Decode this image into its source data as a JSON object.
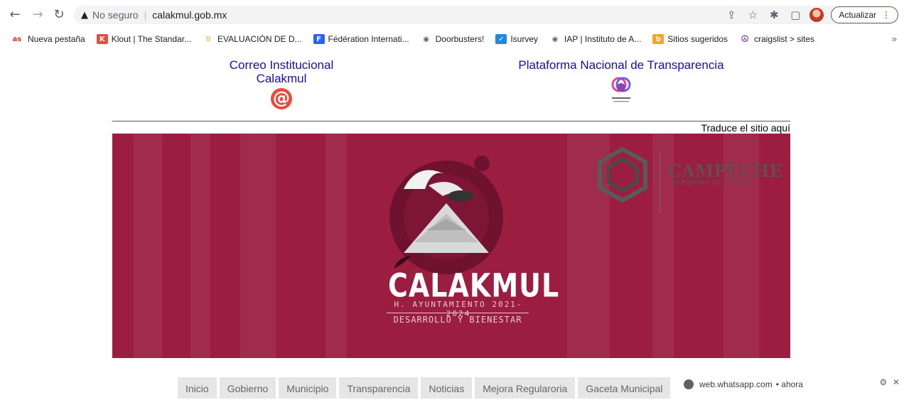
{
  "browser": {
    "security_label": "No seguro",
    "url": "calakmul.gob.mx",
    "update_label": "Actualizar"
  },
  "bookmarks": [
    {
      "label": "Nueva pestaña",
      "icon": "as-icon",
      "icon_text": "as",
      "color": "#c0392b"
    },
    {
      "label": "Klout | The Standar...",
      "icon": "klout-icon",
      "icon_text": "K",
      "color": "#e74c3c"
    },
    {
      "label": "EVALUACIÓN DE D...",
      "icon": "trophy-icon",
      "icon_text": "♉",
      "color": "#f39c12"
    },
    {
      "label": "Fédération Internati...",
      "icon": "f-icon",
      "icon_text": "F",
      "color": "#2962ff"
    },
    {
      "label": "Doorbusters!",
      "icon": "globe-icon",
      "icon_text": "◉",
      "color": "#5f6368"
    },
    {
      "label": "Isurvey",
      "icon": "check-icon",
      "icon_text": "✓",
      "color": "#1e88e5"
    },
    {
      "label": "IAP | Instituto de A...",
      "icon": "globe-icon",
      "icon_text": "◉",
      "color": "#5f6368"
    },
    {
      "label": "Sitios sugeridos",
      "icon": "bing-icon",
      "icon_text": "b",
      "color": "#f5a623"
    },
    {
      "label": "craigslist > sites",
      "icon": "peace-icon",
      "icon_text": "☮",
      "color": "#6a1b9a"
    }
  ],
  "page": {
    "correo_line1": "Correo Institucional",
    "correo_line2": "Calakmul",
    "pnt_title": "Plataforma Nacional de Transparencia",
    "translate": "Traduce el sitio aquí",
    "banner": {
      "name": "CALAKMUL",
      "subtitle": "H. AYUNTAMIENTO 2021-2024",
      "motto": "DESARROLLO Y BIENESTAR",
      "state": "CAMPECHE",
      "state_motto": "GOBIERNO DE TODOS",
      "color": "#9b1e41"
    },
    "menu": [
      "Inicio",
      "Gobierno",
      "Municipio",
      "Transparencia",
      "Noticias",
      "Mejora Regularoria",
      "Gaceta Municipal"
    ]
  },
  "notification": {
    "source": "web.whatsapp.com",
    "time": "• ahora"
  }
}
